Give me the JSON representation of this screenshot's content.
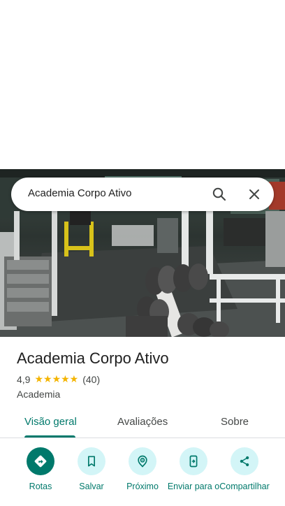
{
  "search": {
    "query": "Academia Corpo Ativo"
  },
  "place": {
    "name": "Academia Corpo Ativo",
    "rating": "4,9",
    "stars": "★★★★★",
    "review_count": "(40)",
    "category": "Academia"
  },
  "tabs": [
    {
      "label": "Visão geral"
    },
    {
      "label": "Avaliações"
    },
    {
      "label": "Sobre"
    }
  ],
  "actions": [
    {
      "label": "Rotas",
      "icon": "directions-icon"
    },
    {
      "label": "Salvar",
      "icon": "bookmark-icon"
    },
    {
      "label": "Próximo",
      "icon": "nearby-icon"
    },
    {
      "label": "Enviar para o",
      "icon": "send-to-phone-icon"
    },
    {
      "label": "Compartilhar",
      "icon": "share-icon"
    }
  ],
  "colors": {
    "accent": "#00796b",
    "action_bg": "#d3f5f7",
    "star": "#f4b400"
  }
}
